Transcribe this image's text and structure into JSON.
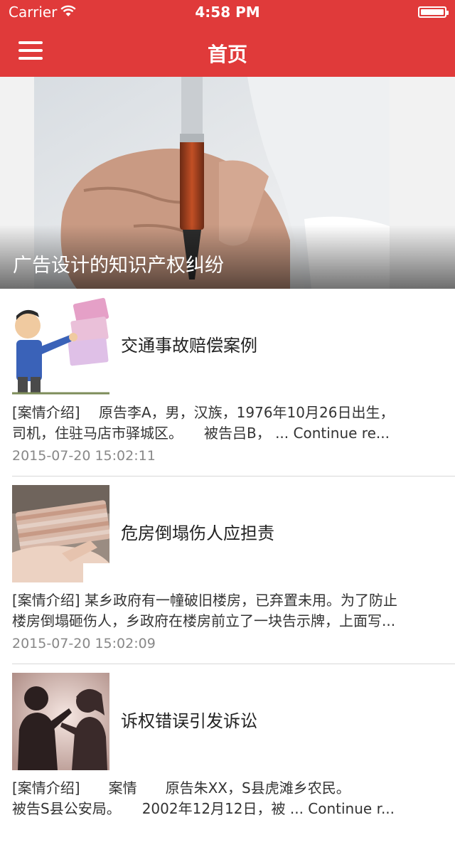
{
  "status_bar": {
    "carrier": "Carrier",
    "time": "4:58 PM"
  },
  "nav": {
    "title": "首页",
    "menu_icon": "hamburger-menu-icon"
  },
  "hero": {
    "caption": "广告设计的知识产权纠纷"
  },
  "articles": [
    {
      "title": "交通事故赔偿案例",
      "summary_line1": "[案情介绍]　 原告李A，男，汉族，1976年10月26日出生，",
      "summary_line2": "司机，住驻马店市驿城区。　　被告吕B，  ... Continue re...",
      "date": "2015-07-20 15:02:11"
    },
    {
      "title": "危房倒塌伤人应担责",
      "summary_line1": "[案情介绍] 某乡政府有一幢破旧楼房，已弃置未用。为了防止",
      "summary_line2": "楼房倒塌砸伤人，乡政府在楼房前立了一块告示牌，上面写...",
      "date": "2015-07-20 15:02:09"
    },
    {
      "title": "诉权错误引发诉讼",
      "summary_line1": "[案情介绍]　　案情　　原告朱XX，S县虎滩乡农民。",
      "summary_line2": "被告S县公安局。　　2002年12月12日，被   ... Continue r...",
      "date": ""
    }
  ]
}
